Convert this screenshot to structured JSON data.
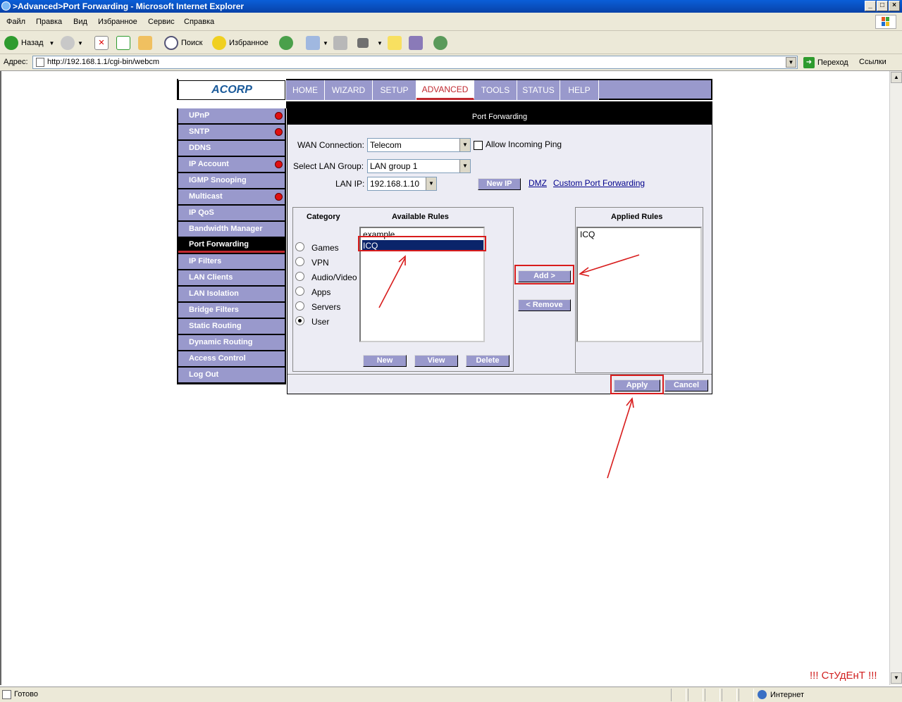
{
  "window": {
    "title": ">Advanced>Port Forwarding - Microsoft Internet Explorer"
  },
  "menu": [
    "Файл",
    "Правка",
    "Вид",
    "Избранное",
    "Сервис",
    "Справка"
  ],
  "toolbar": {
    "back": "Назад",
    "search": "Поиск",
    "favorites": "Избранное"
  },
  "address": {
    "label": "Адрес:",
    "url": "http://192.168.1.1/cgi-bin/webcm",
    "go": "Переход",
    "links": "Ссылки"
  },
  "status": {
    "text": "Готово",
    "zone": "Интернет"
  },
  "watermark": "!!! СтУдЕнТ !!!",
  "router": {
    "logo": "ACORP",
    "nav": [
      "HOME",
      "WIZARD",
      "SETUP",
      "ADVANCED",
      "TOOLS",
      "STATUS",
      "HELP"
    ],
    "sidebar": [
      "UPnP",
      "SNTP",
      "DDNS",
      "IP Account",
      "IGMP Snooping",
      "Multicast",
      "IP QoS",
      "Bandwidth Manager",
      "Port Forwarding",
      "IP Filters",
      "LAN Clients",
      "LAN Isolation",
      "Bridge Filters",
      "Static Routing",
      "Dynamic Routing",
      "Access Control",
      "Log Out"
    ],
    "page_title": "Port Forwarding",
    "wan_label": "WAN Connection:",
    "wan_value": "Telecom",
    "allow_ping": "Allow Incoming Ping",
    "lan_group_label": "Select LAN Group:",
    "lan_group_value": "LAN group 1",
    "lan_ip_label": "LAN IP:",
    "lan_ip_value": "192.168.1.10",
    "new_ip": "New IP",
    "dmz": "DMZ",
    "custom_pf": "Custom Port Forwarding",
    "category_head": "Category",
    "available_head": "Available Rules",
    "applied_head": "Applied Rules",
    "categories": [
      "Games",
      "VPN",
      "Audio/Video",
      "Apps",
      "Servers",
      "User"
    ],
    "selected_category": "User",
    "available_rules": [
      "example",
      "ICQ"
    ],
    "selected_rule": "ICQ",
    "applied_rules": [
      "ICQ"
    ],
    "add": "Add >",
    "remove": "< Remove",
    "new": "New",
    "view": "View",
    "delete": "Delete",
    "apply": "Apply",
    "cancel": "Cancel"
  }
}
